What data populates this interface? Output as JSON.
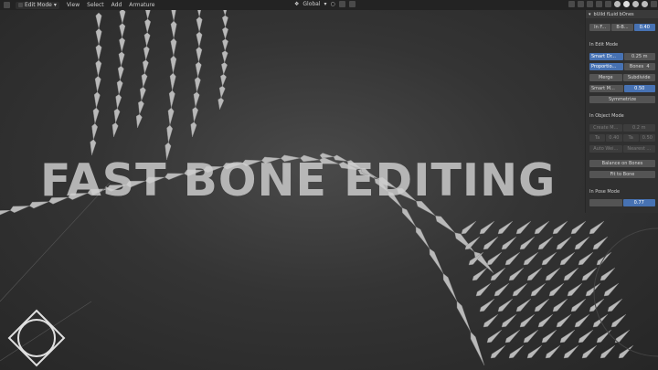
{
  "header": {
    "mode_label": "Edit Mode",
    "menus": [
      "View",
      "Select",
      "Add",
      "Armature"
    ],
    "orientation_label": "Global"
  },
  "overlay_title": "FAST BONE EDITING",
  "panel": {
    "title": "bUild fLuid bOnes",
    "top_row": [
      "In F...",
      "B-B...",
      "0.40"
    ],
    "edit_mode_label": "In Edit Mode",
    "smart_dr_label": "Smart Dr...",
    "smart_dr_value": "0.25 m",
    "proportional_label": "Proportio...",
    "bones_label": "Bones",
    "bones_value": "4",
    "merge_label": "Merge",
    "subdivide_label": "Subdivide",
    "smart_m_label": "Smart M...",
    "smart_m_value": "0.50",
    "symmetrize_label": "Symmetrize",
    "object_mode_label": "In Object Mode",
    "obj_row1": [
      "Create M...",
      "0.2 m"
    ],
    "obj_row2": [
      "Ta",
      "0.40",
      "Ta",
      "0.50"
    ],
    "obj_row3": [
      "Auto Wei...",
      "Nearest ..."
    ],
    "balance_label": "Balance on Bones",
    "fit_label": "Fit to Bone",
    "pose_mode_label": "In Pose Mode",
    "pose_value": "0.77"
  },
  "colors": {
    "accent": "#4772b3",
    "bone": "#b9b9b9"
  }
}
